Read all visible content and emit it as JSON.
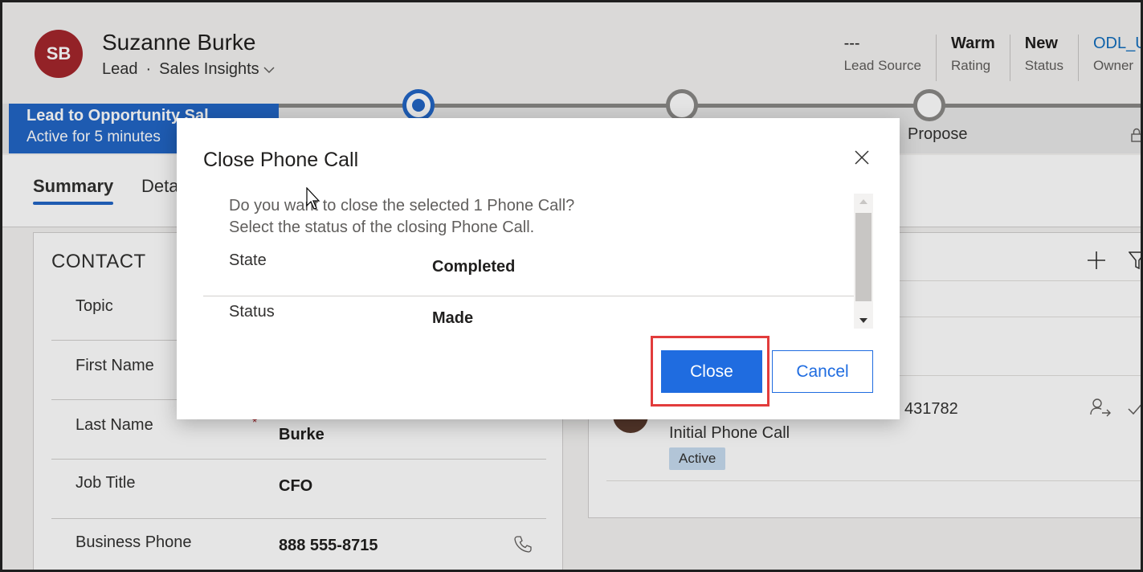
{
  "colors": {
    "accent": "#2266c6",
    "avatar_bg": "#a4262c",
    "highlight": "#e23c3c",
    "badge_bg": "#c7dcf0"
  },
  "header": {
    "avatar_initials": "SB",
    "name": "Suzanne Burke",
    "entity": "Lead",
    "separator": "·",
    "view": "Sales Insights",
    "fields": [
      {
        "value": "---",
        "label": "Lead Source"
      },
      {
        "value": "Warm",
        "label": "Rating"
      },
      {
        "value": "New",
        "label": "Status"
      },
      {
        "value": "ODL_U",
        "label": "Owner"
      }
    ]
  },
  "process": {
    "name": "Lead to Opportunity Sal",
    "active_for": "Active for 5 minutes",
    "stages": [
      {
        "label": ""
      },
      {
        "label": ""
      },
      {
        "label": "Propose"
      }
    ]
  },
  "tabs": [
    {
      "label": "Summary"
    },
    {
      "label": "Deta"
    }
  ],
  "contact": {
    "title": "CONTACT",
    "fields": [
      {
        "label": "Topic",
        "value": ""
      },
      {
        "label": "First Name",
        "value": ""
      },
      {
        "label": "Last Name",
        "value": "Burke",
        "required": "*"
      },
      {
        "label": "Job Title",
        "value": "CFO"
      },
      {
        "label": "Business Phone",
        "value": "888 555-8715"
      }
    ]
  },
  "timeline": {
    "activity_id": "431782",
    "activity_title": "Initial Phone Call",
    "activity_status": "Active"
  },
  "dialog": {
    "title": "Close Phone Call",
    "message_line1": "Do you want to close the selected 1 Phone Call?",
    "message_line2": "Select the status of the closing Phone Call.",
    "state_label": "State",
    "state_value": "Completed",
    "status_label": "Status",
    "status_value": "Made",
    "close_button": "Close",
    "cancel_button": "Cancel"
  }
}
